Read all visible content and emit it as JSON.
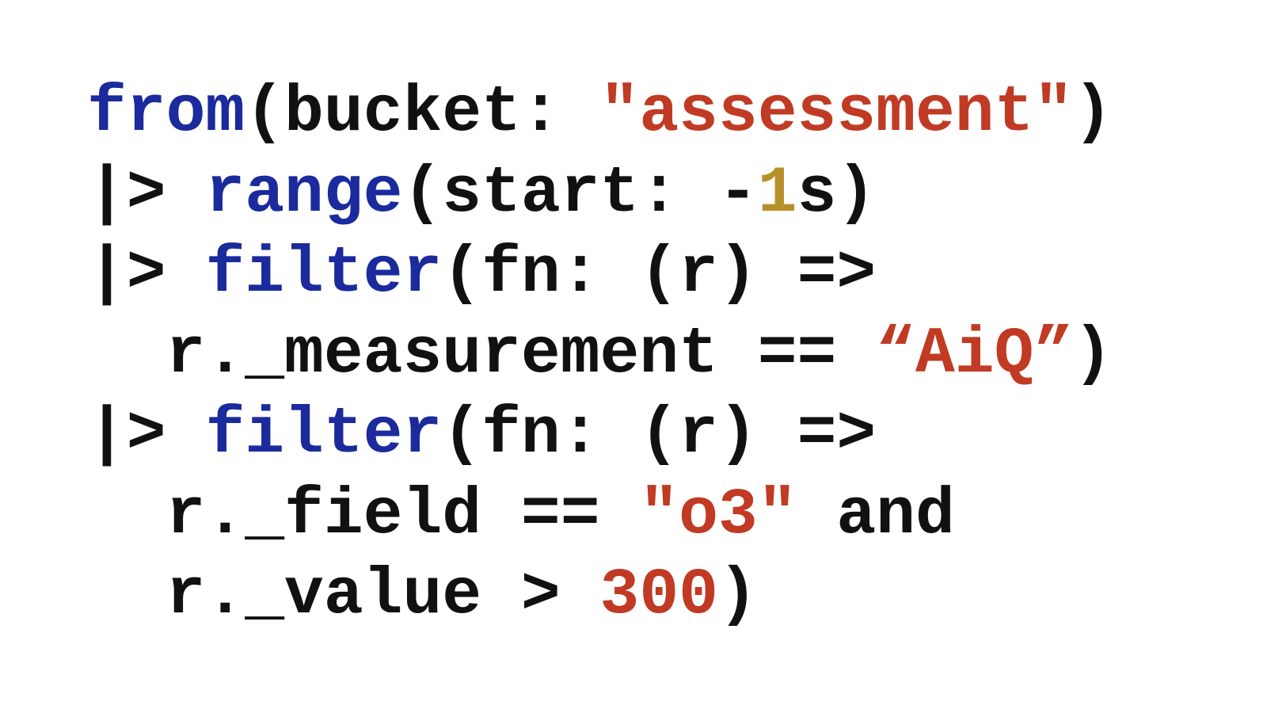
{
  "colors": {
    "keyword": "#1b2a9c",
    "string": "#c13a23",
    "number_highlight": "#b8902a",
    "number": "#c13a23",
    "text": "#111111",
    "background": "#ffffff"
  },
  "code": {
    "lines": [
      [
        {
          "text": "from",
          "type": "kw"
        },
        {
          "text": "(bucket: ",
          "type": "plain"
        },
        {
          "text": "\"assessment\"",
          "type": "str"
        },
        {
          "text": ")",
          "type": "plain"
        }
      ],
      [
        {
          "text": "|> ",
          "type": "plain"
        },
        {
          "text": "range",
          "type": "kw"
        },
        {
          "text": "(start: -",
          "type": "plain"
        },
        {
          "text": "1",
          "type": "num-y"
        },
        {
          "text": "s)",
          "type": "plain"
        }
      ],
      [
        {
          "text": "|> ",
          "type": "plain"
        },
        {
          "text": "filter",
          "type": "kw"
        },
        {
          "text": "(fn: (r) =>",
          "type": "plain"
        }
      ],
      [
        {
          "text": "  r._measurement == ",
          "type": "plain"
        },
        {
          "text": "“AiQ”",
          "type": "str"
        },
        {
          "text": ")",
          "type": "plain"
        }
      ],
      [
        {
          "text": "|> ",
          "type": "plain"
        },
        {
          "text": "filter",
          "type": "kw"
        },
        {
          "text": "(fn: (r) =>",
          "type": "plain"
        }
      ],
      [
        {
          "text": "  r._field == ",
          "type": "plain"
        },
        {
          "text": "\"o3\"",
          "type": "str"
        },
        {
          "text": " and",
          "type": "plain"
        }
      ],
      [
        {
          "text": "  r._value > ",
          "type": "plain"
        },
        {
          "text": "300",
          "type": "num-r"
        },
        {
          "text": ")",
          "type": "plain"
        }
      ]
    ]
  }
}
